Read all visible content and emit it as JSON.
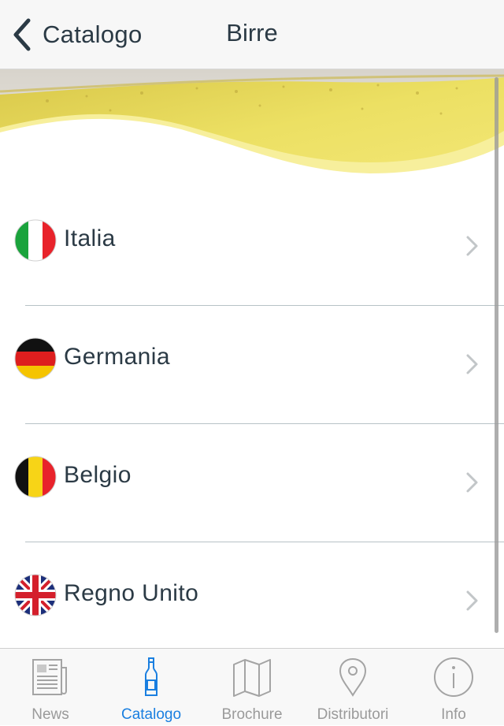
{
  "navbar": {
    "back_label": "Catalogo",
    "title": "Birre"
  },
  "countries": [
    {
      "label": "Italia",
      "flag": "italy-flag-icon"
    },
    {
      "label": "Germania",
      "flag": "germany-flag-icon"
    },
    {
      "label": "Belgio",
      "flag": "belgium-flag-icon"
    },
    {
      "label": "Regno Unito",
      "flag": "uk-flag-icon"
    }
  ],
  "tabs": [
    {
      "label": "News",
      "icon": "newspaper-icon",
      "active": false
    },
    {
      "label": "Catalogo",
      "icon": "bottle-icon",
      "active": true
    },
    {
      "label": "Brochure",
      "icon": "map-icon",
      "active": false
    },
    {
      "label": "Distributori",
      "icon": "location-pin-icon",
      "active": false
    },
    {
      "label": "Info",
      "icon": "info-icon",
      "active": false
    }
  ],
  "colors": {
    "text": "#2b3a45",
    "accent": "#1a7fe0",
    "inactive": "#9a9a9a",
    "beer_yellow": "#f0e25a"
  }
}
